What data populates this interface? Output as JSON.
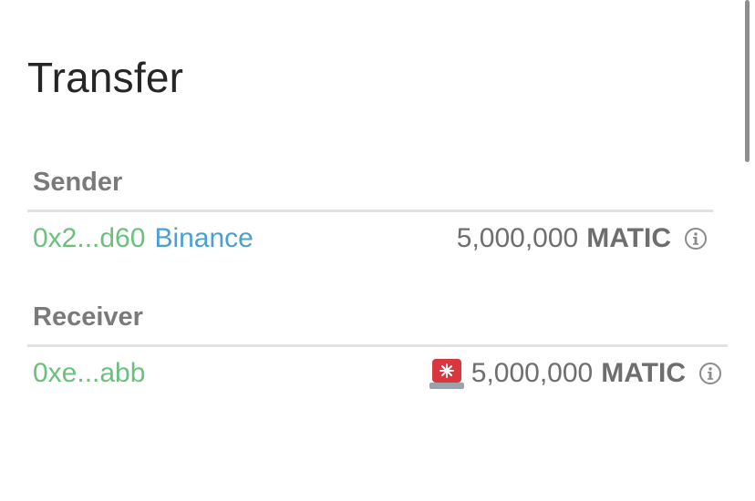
{
  "title": "Transfer",
  "sender": {
    "label": "Sender",
    "address": "0x2...d60",
    "entity": "Binance",
    "amount": "5,000,000",
    "unit": "MATIC",
    "info_icon": "info-circle-icon"
  },
  "receiver": {
    "label": "Receiver",
    "address": "0xe...abb",
    "alert_icon": "siren-icon",
    "amount": "5,000,000",
    "unit": "MATIC",
    "info_icon": "info-circle-icon"
  },
  "colors": {
    "address": "#6bc07d",
    "entity": "#4a9fd4",
    "label": "#7a7a7a",
    "siren": "#d9363e"
  }
}
